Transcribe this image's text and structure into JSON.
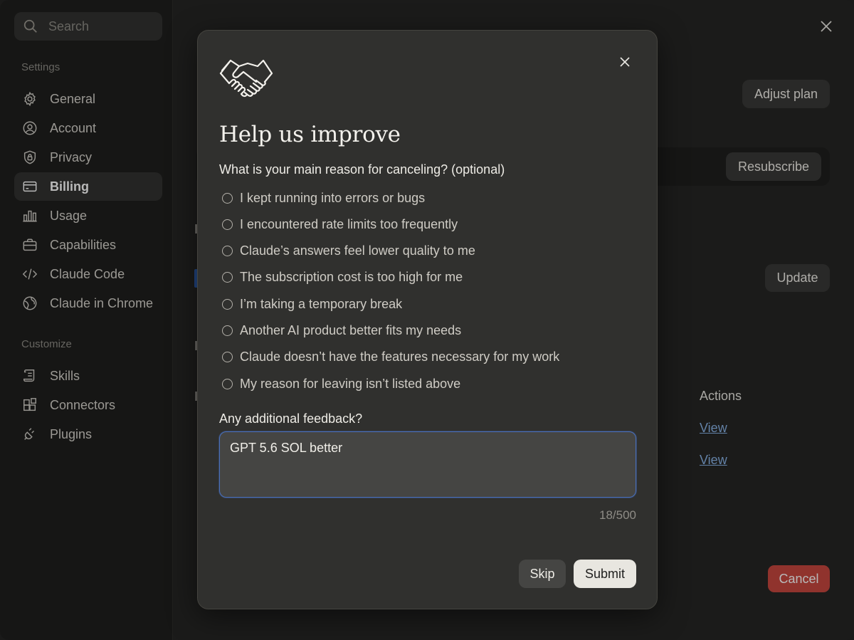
{
  "sidebar": {
    "search_placeholder": "Search",
    "settings_label": "Settings",
    "customize_label": "Customize",
    "settings_items": [
      {
        "label": "General",
        "icon": "gear-icon"
      },
      {
        "label": "Account",
        "icon": "user-circle-icon"
      },
      {
        "label": "Privacy",
        "icon": "shield-icon"
      },
      {
        "label": "Billing",
        "icon": "credit-card-icon",
        "active": true
      },
      {
        "label": "Usage",
        "icon": "bar-chart-icon"
      },
      {
        "label": "Capabilities",
        "icon": "briefcase-icon"
      },
      {
        "label": "Claude Code",
        "icon": "code-icon"
      },
      {
        "label": "Claude in Chrome",
        "icon": "globe-icon"
      }
    ],
    "customize_items": [
      {
        "label": "Skills",
        "icon": "scroll-icon"
      },
      {
        "label": "Connectors",
        "icon": "blocks-icon"
      },
      {
        "label": "Plugins",
        "icon": "plug-icon"
      }
    ]
  },
  "main": {
    "adjust_plan_label": "Adjust plan",
    "resubscribe_label": "Resubscribe",
    "update_label": "Update",
    "actions_header": "Actions",
    "view_links": [
      "View",
      "View"
    ],
    "cancel_label": "Cancel"
  },
  "modal": {
    "title": "Help us improve",
    "question": "What is your main reason for canceling? (optional)",
    "options": [
      "I kept running into errors or bugs",
      "I encountered rate limits too frequently",
      "Claude’s answers feel lower quality to me",
      "The subscription cost is too high for me",
      "I’m taking a temporary break",
      "Another AI product better fits my needs",
      "Claude doesn’t have the features necessary for my work",
      "My reason for leaving isn’t listed above"
    ],
    "feedback_label": "Any additional feedback?",
    "feedback_value": "GPT 5.6 SOL better",
    "char_counter": "18/500",
    "skip_label": "Skip",
    "submit_label": "Submit"
  },
  "colors": {
    "accent_blue": "#4a6fb8",
    "cancel_red": "#c8473f",
    "link_blue": "#8ab4e8"
  }
}
